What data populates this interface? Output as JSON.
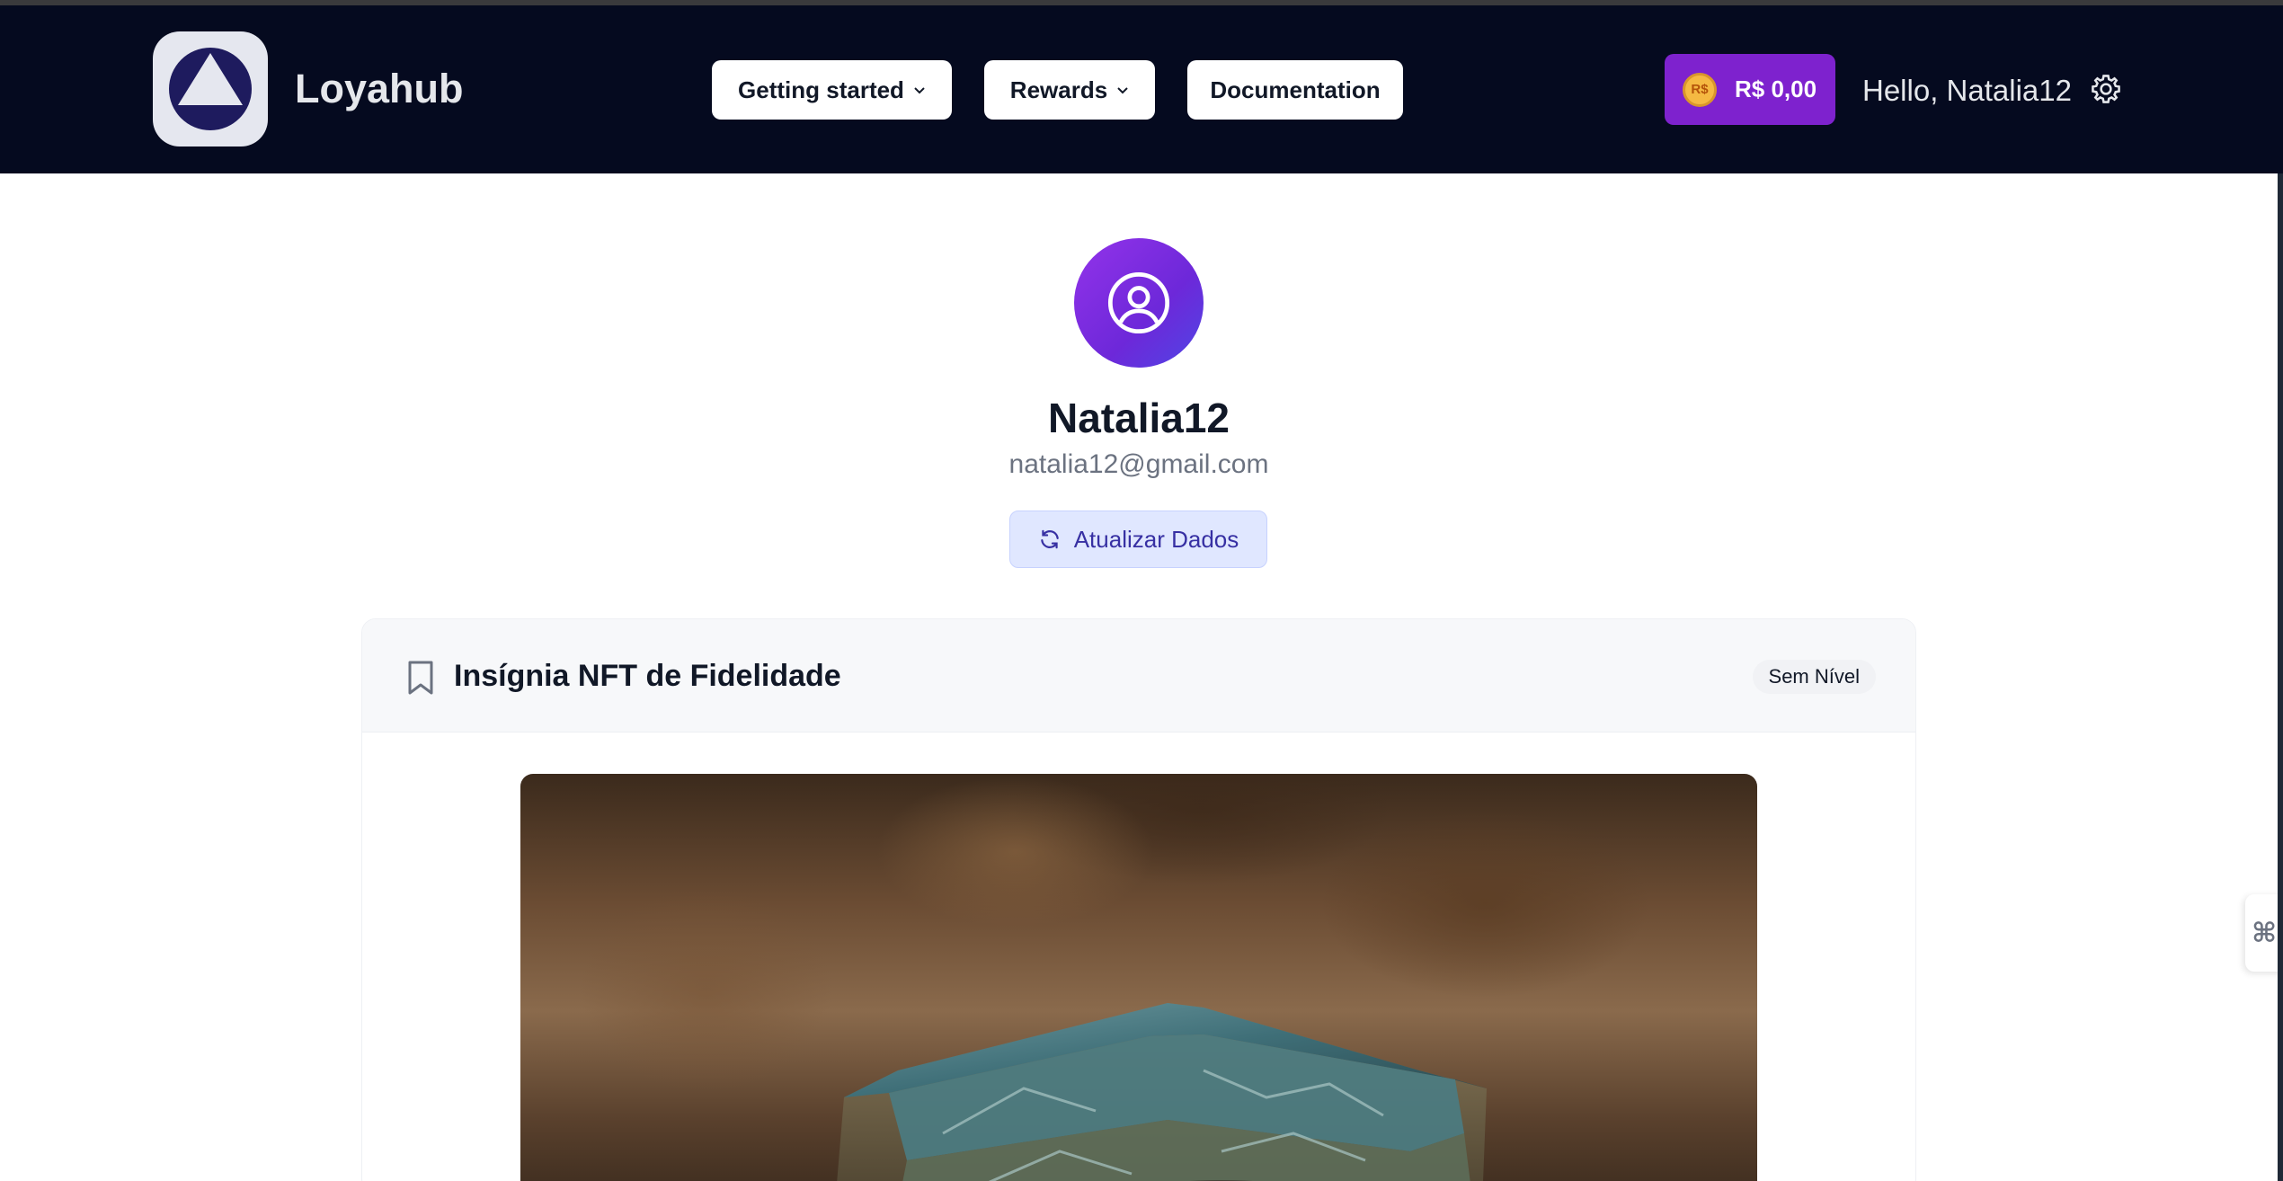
{
  "header": {
    "brand": "Loyahub",
    "nav": [
      {
        "label": "Getting started",
        "has_dropdown": true
      },
      {
        "label": "Rewards",
        "has_dropdown": true
      },
      {
        "label": "Documentation",
        "has_dropdown": false
      }
    ],
    "wallet": {
      "coin_label": "R$",
      "amount": "R$ 0,00"
    },
    "greeting": "Hello, Natalia12",
    "settings_icon": "gear-icon"
  },
  "profile": {
    "username": "Natalia12",
    "email": "natalia12@gmail.com",
    "refresh_label": "Atualizar Dados"
  },
  "nft_card": {
    "title": "Insígnia NFT de Fidelidade",
    "level": "Sem Nível"
  },
  "side_tab": {
    "glyph": "⌘"
  },
  "colors": {
    "navbar_bg": "#050a1f",
    "wallet_bg": "#7e22ce",
    "avatar_gradient": [
      "#9333ea",
      "#4f46e5"
    ],
    "refresh_bg": "#e0e7ff",
    "refresh_text": "#3730a3"
  }
}
